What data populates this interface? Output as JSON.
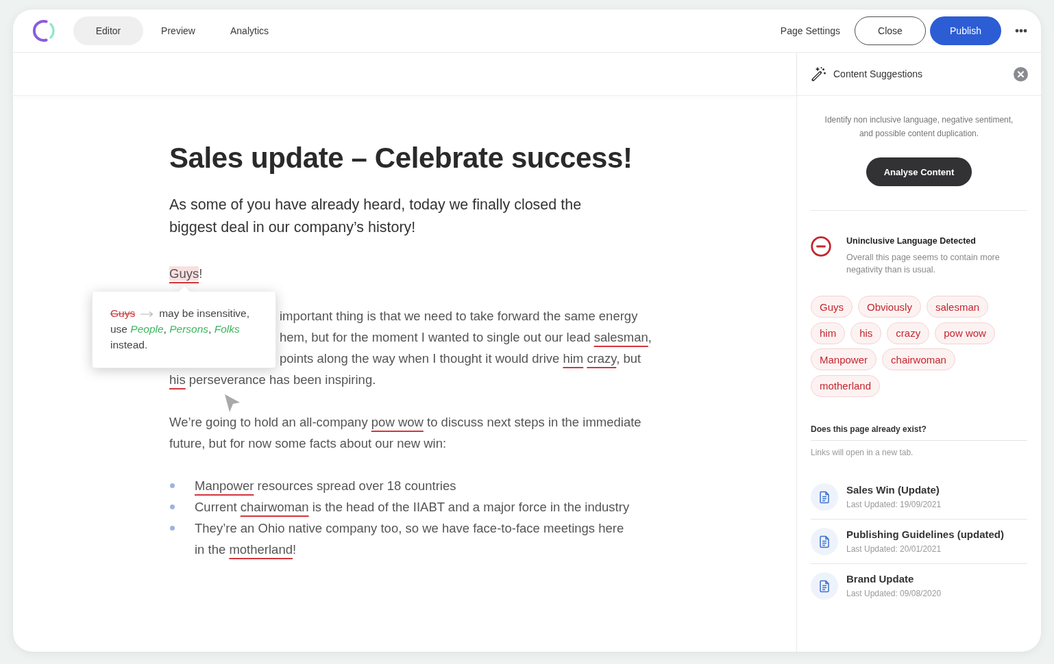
{
  "top_bar": {
    "tabs": [
      {
        "label": "Editor",
        "selected": true
      },
      {
        "label": "Preview",
        "selected": false
      },
      {
        "label": "Analytics",
        "selected": false
      }
    ],
    "page_settings": "Page Settings",
    "close_button": "Close",
    "publish_button": "Publish"
  },
  "editor": {
    "title": "Sales update – Celebrate success!",
    "blocks": [
      {
        "kind": "lead",
        "lines": [
          [
            "As some of you have already heard, today we finally closed the"
          ],
          [
            "biggest deal in our company’s history!"
          ]
        ]
      },
      {
        "kind": "paragraph",
        "lines": [
          [
            {
              "flag": "Guys",
              "selected": true
            },
            "!"
          ]
        ]
      },
      {
        "kind": "paragraph",
        "tooltip": {
          "term": "Guys",
          "message": "may be insensitive, use *People*, *Persons*, *Folks* instead."
        },
        "lines": [
          [
            "important thing is that we need to take forward the same energy"
          ],
          [
            "hem, but for the moment I wanted to single out our lead ",
            {
              "flag": "salesman",
              "selected": false
            },
            ","
          ],
          [
            "points along the way when I thought it would drive ",
            {
              "flag": "him",
              "selected": false
            },
            {
              "flag": "crazy",
              "selected": false
            },
            ", but"
          ],
          [
            {
              "flag": "his",
              "selected": false
            },
            " perseverance has been inspiring."
          ]
        ]
      },
      {
        "kind": "paragraph",
        "lines": [
          [
            "We’re going to hold an all-company ",
            {
              "flag": "pow wow",
              "selected": false
            },
            " to discuss next steps in the immediate"
          ],
          [
            "future, but for now some facts about our new win:"
          ]
        ]
      },
      {
        "kind": "bullets",
        "items": [
          {
            "lines": [
              [
                {
                  "flag": "Manpower",
                  "selected": false
                },
                " resources spread over 18 countries"
              ]
            ]
          },
          {
            "lines": [
              [
                "Current ",
                {
                  "flag": "chairwoman",
                  "selected": false
                },
                " is the head of the IIABT and a major force in the industry"
              ]
            ]
          },
          {
            "lines": [
              [
                "They’re an Ohio native company too, so we have face-to-face meetings here"
              ],
              [
                "in the ",
                {
                  "flag": "motherland",
                  "selected": false
                },
                "!"
              ]
            ]
          }
        ]
      }
    ]
  },
  "panel": {
    "title": "Content Suggestions",
    "description": "Identify non inclusive language, negative sentiment, and possible content duplication.",
    "analyse_button": "Analyse Content",
    "alert": {
      "title": "Uninclusive Language Detected",
      "message": "Overall this page seems to contain more negativity than is usual."
    },
    "flagged_terms": [
      "Guys",
      "Obviously",
      "salesman",
      "him",
      "his",
      "crazy",
      "pow wow",
      "Manpower",
      "chairwoman",
      "motherland"
    ],
    "existing_pages": {
      "heading": "Does this page already exist?",
      "note": "Links will open in a new tab.",
      "pages": [
        {
          "title": "Sales Win (Update)",
          "updated": "Last Updated: 19/09/2021"
        },
        {
          "title": "Publishing Guidelines (updated)",
          "updated": "Last Updated: 20/01/2021"
        },
        {
          "title": "Brand Update",
          "updated": "Last Updated: 09/08/2020"
        }
      ]
    }
  }
}
